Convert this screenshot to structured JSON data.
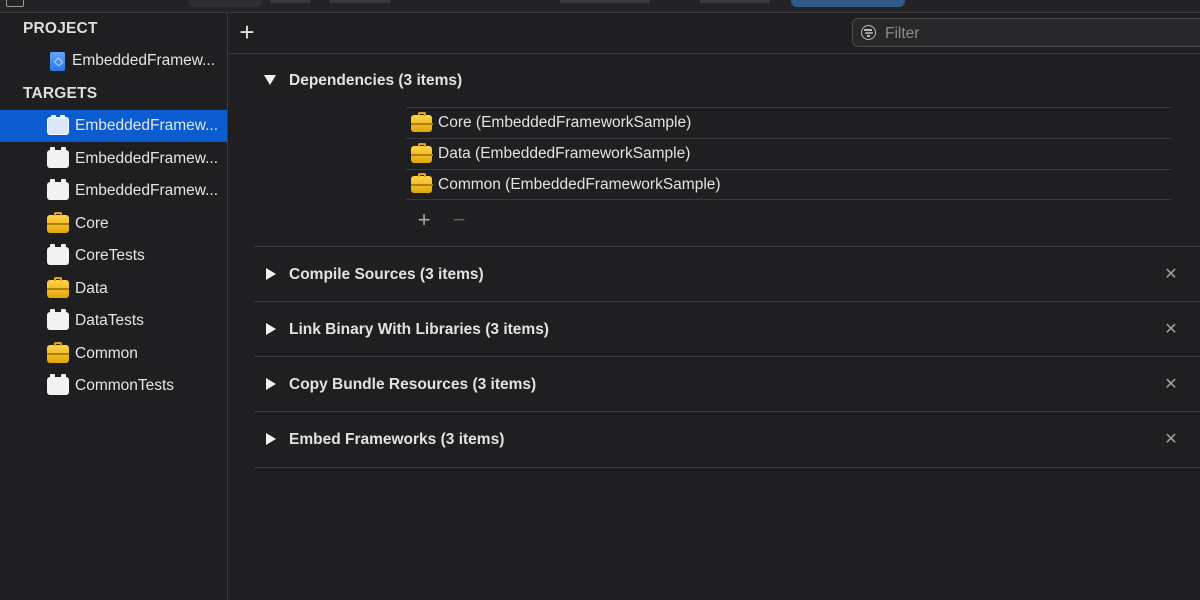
{
  "sidebar": {
    "project_header": "PROJECT",
    "project_item": {
      "label": "EmbeddedFramew...",
      "icon": "project-document-icon"
    },
    "targets_header": "TARGETS",
    "targets": [
      {
        "label": "EmbeddedFramew...",
        "icon": "app-target-icon",
        "selected": true
      },
      {
        "label": "EmbeddedFramew...",
        "icon": "test-target-icon"
      },
      {
        "label": "EmbeddedFramew...",
        "icon": "test-target-icon"
      },
      {
        "label": "Core",
        "icon": "framework-icon"
      },
      {
        "label": "CoreTests",
        "icon": "test-target-icon"
      },
      {
        "label": "Data",
        "icon": "framework-icon"
      },
      {
        "label": "DataTests",
        "icon": "test-target-icon"
      },
      {
        "label": "Common",
        "icon": "framework-icon"
      },
      {
        "label": "CommonTests",
        "icon": "test-target-icon"
      }
    ]
  },
  "toolbar": {
    "add_label": "+",
    "filter_placeholder": "Filter"
  },
  "phases": [
    {
      "title": "Dependencies (3 items)",
      "expanded": true,
      "items": [
        {
          "label": "Core (EmbeddedFrameworkSample)",
          "icon": "framework-icon"
        },
        {
          "label": "Data (EmbeddedFrameworkSample)",
          "icon": "framework-icon"
        },
        {
          "label": "Common (EmbeddedFrameworkSample)",
          "icon": "framework-icon"
        }
      ],
      "add_label": "+",
      "remove_label": "−"
    },
    {
      "title": "Compile Sources (3 items)",
      "expanded": false,
      "close_label": "✕"
    },
    {
      "title": "Link Binary With Libraries (3 items)",
      "expanded": false,
      "close_label": "✕"
    },
    {
      "title": "Copy Bundle Resources (3 items)",
      "expanded": false,
      "close_label": "✕"
    },
    {
      "title": "Embed Frameworks (3 items)",
      "expanded": false,
      "close_label": "✕"
    }
  ],
  "colors": {
    "background": "#1f1f21",
    "selection": "#0a5ccf",
    "separator": "#3a3a3c",
    "framework_icon": "#f0b71c"
  }
}
